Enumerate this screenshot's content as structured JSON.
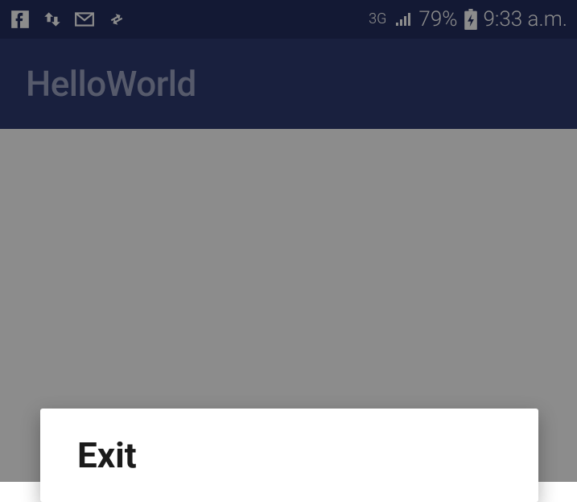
{
  "status_bar": {
    "network_label": "3G",
    "battery_percent": "79%",
    "time": "9:33 a.m."
  },
  "app_bar": {
    "title": "HelloWorld"
  },
  "dialog": {
    "title": "Exit"
  }
}
